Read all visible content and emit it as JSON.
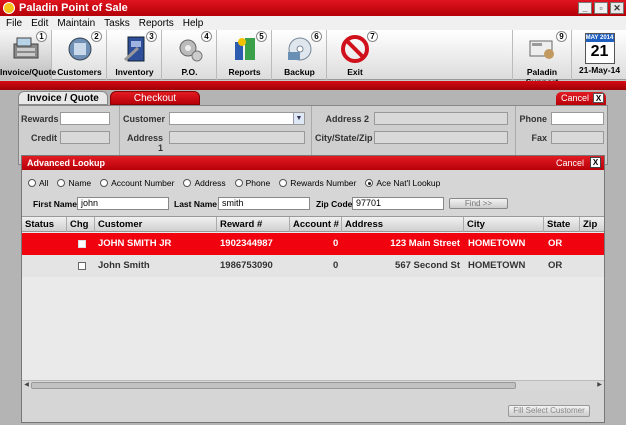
{
  "window": {
    "title": "Paladin Point of Sale",
    "controls": [
      "_",
      "▫",
      "✕"
    ]
  },
  "menu": [
    "File",
    "Edit",
    "Maintain",
    "Tasks",
    "Reports",
    "Help"
  ],
  "toolbar": {
    "tools": [
      {
        "label": "Invoice/Quote",
        "num": "1",
        "icon": "register-icon"
      },
      {
        "label": "Customers",
        "num": "2",
        "icon": "customers-icon"
      },
      {
        "label": "Inventory",
        "num": "3",
        "icon": "inventory-icon"
      },
      {
        "label": "P.O.",
        "num": "4",
        "icon": "purchase-order-icon"
      },
      {
        "label": "Reports",
        "num": "5",
        "icon": "reports-icon"
      },
      {
        "label": "Backup",
        "num": "6",
        "icon": "backup-icon"
      },
      {
        "label": "Exit",
        "num": "7",
        "icon": "exit-icon"
      }
    ],
    "support": {
      "label": "Paladin Support",
      "num": "9"
    },
    "calendar": {
      "month": "MAY 2014",
      "day": "21",
      "label": "21-May-14"
    }
  },
  "tabs": {
    "invoice": "Invoice / Quote",
    "checkout": "Checkout",
    "cancel": "Cancel",
    "close": "X"
  },
  "customer_panel": {
    "rewards": "Rewards",
    "credit": "Credit",
    "customer": "Customer",
    "address1": "Address 1",
    "address2": "Address 2",
    "city_state_zip": "City/State/Zip",
    "phone": "Phone",
    "fax": "Fax"
  },
  "lookup": {
    "title": "Advanced Lookup",
    "cancel": "Cancel",
    "close": "X",
    "radios": [
      {
        "label": "All",
        "checked": false
      },
      {
        "label": "Name",
        "checked": false
      },
      {
        "label": "Account Number",
        "checked": false
      },
      {
        "label": "Address",
        "checked": false
      },
      {
        "label": "Phone",
        "checked": false
      },
      {
        "label": "Rewards Number",
        "checked": false
      },
      {
        "label": "Ace Nat'l Lookup",
        "checked": true
      }
    ],
    "first_name_label": "First Name",
    "first_name": "john",
    "last_name_label": "Last Name",
    "last_name": "smith",
    "zip_label": "Zip Code",
    "zip": "97701",
    "find": "Find >>",
    "columns": [
      "Status",
      "Chg",
      "Customer",
      "Reward #",
      "Account #",
      "Address",
      "City",
      "State",
      "Zip"
    ],
    "rows": [
      {
        "customer": "JOHN SMITH JR",
        "reward": "1902344987",
        "account": "0",
        "address": "123 Main Street",
        "city": "HOMETOWN",
        "state": "OR",
        "selected": true
      },
      {
        "customer": "John Smith",
        "reward": "1986753090",
        "account": "0",
        "address": "567 Second St",
        "city": "HOMETOWN",
        "state": "OR",
        "selected": false
      }
    ],
    "fill_button": "Fill Select Customer"
  }
}
